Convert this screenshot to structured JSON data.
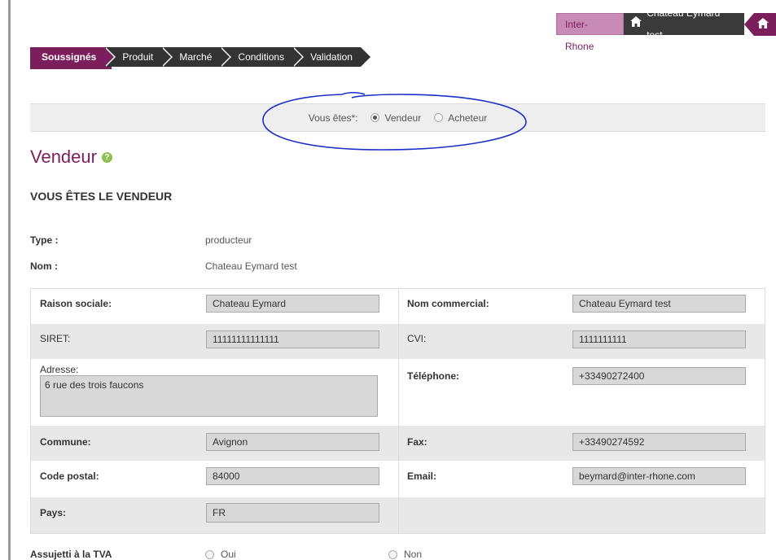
{
  "header": {
    "org_label": "Inter-Rhone",
    "user_label": "Chateau Eymard test"
  },
  "steps": [
    "Soussignés",
    "Produit",
    "Marché",
    "Conditions",
    "Validation"
  ],
  "role": {
    "label": "Vous êtes*:",
    "options": [
      {
        "label": "Vendeur",
        "checked": true
      },
      {
        "label": "Acheteur",
        "checked": false
      }
    ]
  },
  "section": {
    "title": "Vendeur",
    "subtitle": "VOUS ÊTES LE VENDEUR"
  },
  "info": {
    "type_label": "Type :",
    "type_value": "producteur",
    "nom_label": "Nom :",
    "nom_value": "Chateau Eymard test"
  },
  "form": {
    "raison_sociale": {
      "label": "Raison sociale:",
      "value": "Chateau Eymard"
    },
    "nom_commercial": {
      "label": "Nom commercial:",
      "value": "Chateau Eymard test"
    },
    "siret": {
      "label": "SIRET:",
      "value": "11111111111111"
    },
    "cvi": {
      "label": "CVI:",
      "value": "1111111111"
    },
    "adresse": {
      "label": "Adresse:",
      "value": "6 rue des trois faucons"
    },
    "telephone": {
      "label": "Téléphone:",
      "value": "+33490272400"
    },
    "commune": {
      "label": "Commune:",
      "value": "Avignon"
    },
    "fax": {
      "label": "Fax:",
      "value": "+33490274592"
    },
    "code_postal": {
      "label": "Code postal:",
      "value": "84000"
    },
    "email": {
      "label": "Email:",
      "value": "beymard@inter-rhone.com"
    },
    "pays": {
      "label": "Pays:",
      "value": "FR"
    }
  },
  "tva": {
    "label": "Assujetti à la TVA",
    "oui": "Oui",
    "non": "Non"
  },
  "colors": {
    "accent": "#7a1f5c",
    "annotation": "#1a2fc7"
  }
}
